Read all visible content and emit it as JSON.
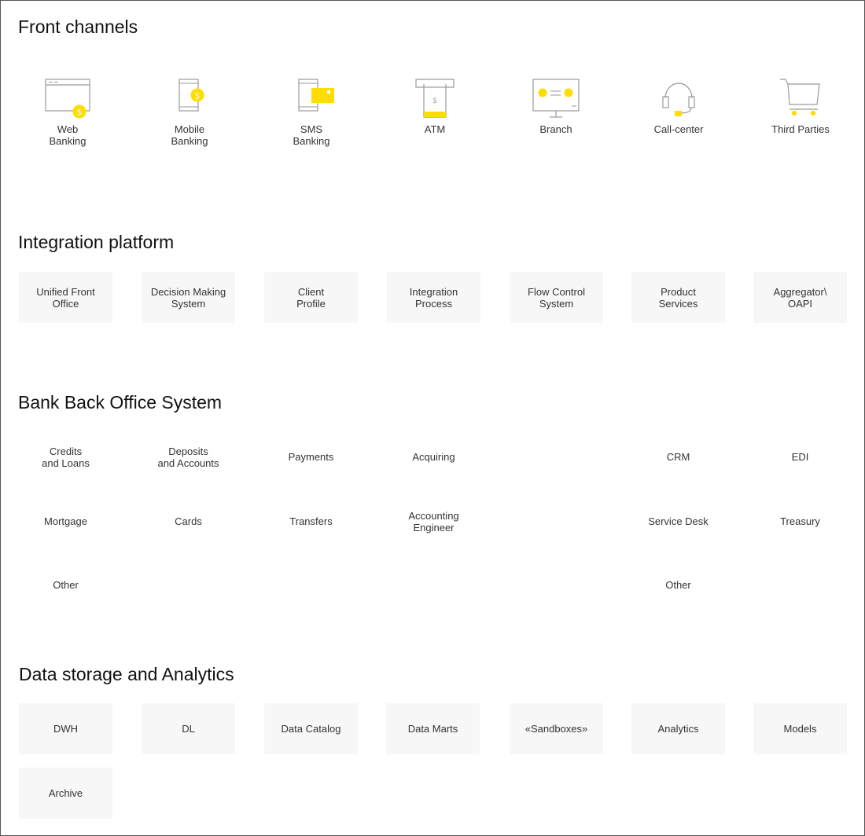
{
  "sections": {
    "front": "Front channels",
    "integration": "Integration platform",
    "backoffice": "Bank Back Office System",
    "data": "Data storage and Analytics"
  },
  "front_channels": [
    {
      "label": "Web\nBanking",
      "icon": "web-banking-icon"
    },
    {
      "label": "Mobile\nBanking",
      "icon": "mobile-banking-icon"
    },
    {
      "label": "SMS\nBanking",
      "icon": "sms-banking-icon"
    },
    {
      "label": "ATM",
      "icon": "atm-icon"
    },
    {
      "label": "Branch",
      "icon": "branch-icon"
    },
    {
      "label": "Call-center",
      "icon": "headset-icon"
    },
    {
      "label": "Third Parties",
      "icon": "cart-icon"
    }
  ],
  "integration_items": [
    "Unified Front\nOffice",
    "Decision Making\nSystem",
    "Client\nProfile",
    "Integration\nProcess",
    "Flow Control\nSystem",
    "Product\nServices",
    "Aggregator\\\nOAPI"
  ],
  "backoffice_rows": [
    [
      "Credits\nand Loans",
      "Deposits\nand Accounts",
      "Payments",
      "Acquiring",
      "",
      "CRM",
      "EDI"
    ],
    [
      "Mortgage",
      "Cards",
      "Transfers",
      "Accounting\nEngineer",
      "",
      "Service Desk",
      "Treasury"
    ],
    [
      "Other",
      "",
      "",
      "",
      "",
      "Other",
      ""
    ]
  ],
  "data_items": [
    "DWH",
    "DL",
    "Data Catalog",
    "Data Marts",
    "«Sandboxes»",
    "Analytics",
    "Models",
    "Archive"
  ],
  "colors": {
    "accent": "#ffdd00",
    "box_bg": "#f7f7f7",
    "icon_stroke": "#999999"
  }
}
